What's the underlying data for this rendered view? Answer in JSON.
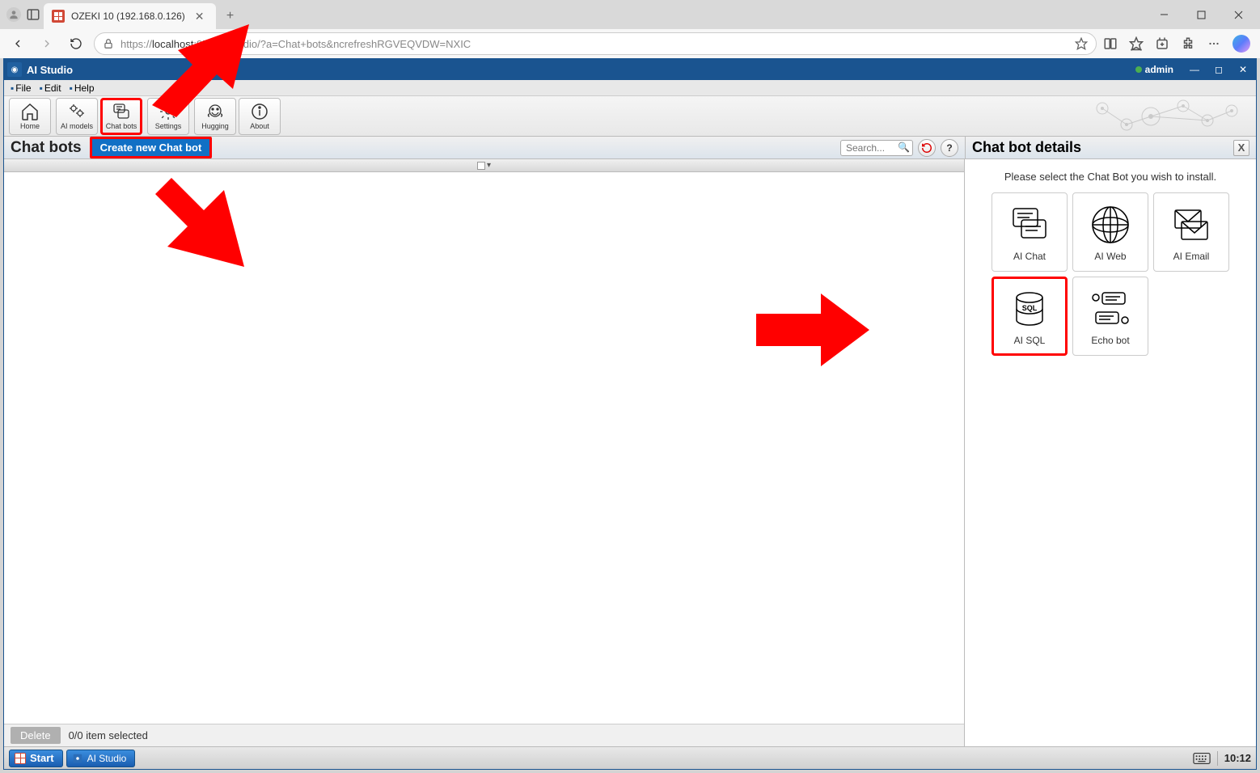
{
  "browser": {
    "tab_title": "OZEKI 10 (192.168.0.126)",
    "url_prefix": "https://",
    "url_host": "localhost",
    "url_rest": ":9515/...  ...dio/?a=Chat+bots&ncrefreshRGVEQVDW=NXIC"
  },
  "app": {
    "title": "AI Studio",
    "user": "admin",
    "menus": [
      "File",
      "Edit",
      "Help"
    ],
    "toolbar": [
      {
        "label": "Home"
      },
      {
        "label": "AI models"
      },
      {
        "label": "Chat bots"
      },
      {
        "label": "Settings"
      },
      {
        "label": "Hugging"
      },
      {
        "label": "About"
      }
    ],
    "page_title": "Chat bots",
    "create_button": "Create new Chat bot",
    "search_placeholder": "Search...",
    "delete_label": "Delete",
    "selection_text": "0/0 item selected"
  },
  "details": {
    "title": "Chat bot details",
    "message": "Please select the Chat Bot you wish to install.",
    "bots": [
      "AI Chat",
      "AI Web",
      "AI Email",
      "AI SQL",
      "Echo bot"
    ]
  },
  "taskbar": {
    "start": "Start",
    "task1": "AI Studio",
    "time": "10:12"
  }
}
